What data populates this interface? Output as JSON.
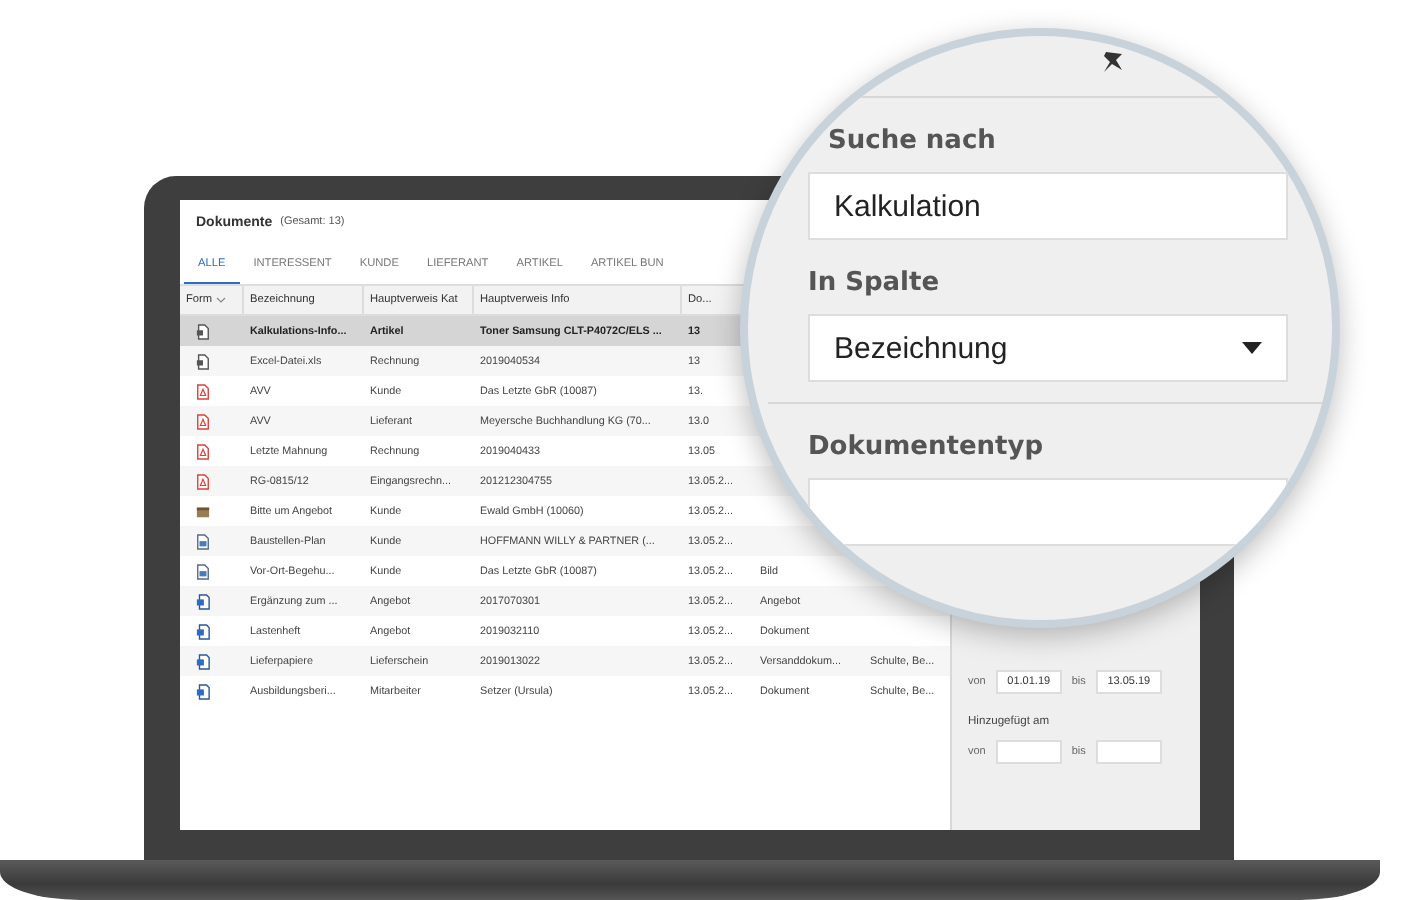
{
  "screen": {
    "title": "Dokumente",
    "count": "(Gesamt: 13)",
    "tabs": [
      {
        "label": "ALLE",
        "selected": true
      },
      {
        "label": "INTERESSENT",
        "selected": false
      },
      {
        "label": "KUNDE",
        "selected": false
      },
      {
        "label": "LIEFERANT",
        "selected": false
      },
      {
        "label": "ARTIKEL",
        "selected": false
      },
      {
        "label": "ARTIKEL BUN",
        "selected": false
      }
    ],
    "table": {
      "form_column": "Form",
      "columns": [
        "Bezeichnung",
        "Hauptverweis Kat",
        "Hauptverweis Info",
        "Do..."
      ],
      "rows": [
        {
          "kind": "file",
          "selected": true,
          "cells": [
            "Kalkulations-Info...",
            "Artikel",
            "Toner Samsung CLT-P4072C/ELS ...",
            "13"
          ]
        },
        {
          "kind": "file",
          "selected": false,
          "cells": [
            "Excel-Datei.xls",
            "Rechnung",
            "2019040534",
            "13"
          ]
        },
        {
          "kind": "pdf",
          "selected": false,
          "cells": [
            "AVV",
            "Kunde",
            "Das Letzte GbR (10087)",
            "13."
          ]
        },
        {
          "kind": "pdf",
          "selected": false,
          "cells": [
            "AVV",
            "Lieferant",
            "Meyersche Buchhandlung KG (70...",
            "13.0"
          ]
        },
        {
          "kind": "pdf",
          "selected": false,
          "cells": [
            "Letzte Mahnung",
            "Rechnung",
            "2019040433",
            "13.05"
          ]
        },
        {
          "kind": "pdf",
          "selected": false,
          "cells": [
            "RG-0815/12",
            "Eingangsrechn...",
            "201212304755",
            "13.05.2..."
          ]
        },
        {
          "kind": "box",
          "selected": false,
          "cells": [
            "Bitte um Angebot",
            "Kunde",
            "Ewald GmbH (10060)",
            "13.05.2..."
          ]
        },
        {
          "kind": "image",
          "selected": false,
          "cells": [
            "Baustellen-Plan",
            "Kunde",
            "HOFFMANN WILLY & PARTNER (...",
            "13.05.2..."
          ]
        },
        {
          "kind": "image",
          "selected": false,
          "cells": [
            "Vor-Ort-Begehu...",
            "Kunde",
            "Das Letzte GbR (10087)",
            "13.05.2...",
            "Bild"
          ]
        },
        {
          "kind": "word",
          "selected": false,
          "cells": [
            "Ergänzung zum ...",
            "Angebot",
            "2017070301",
            "13.05.2...",
            "Angebot"
          ]
        },
        {
          "kind": "word",
          "selected": false,
          "cells": [
            "Lastenheft",
            "Angebot",
            "2019032110",
            "13.05.2...",
            "Dokument"
          ]
        },
        {
          "kind": "word",
          "selected": false,
          "cells": [
            "Lieferpapiere",
            "Lieferschein",
            "2019013022",
            "13.05.2...",
            "Versanddokum...",
            "Schulte, Be..."
          ]
        },
        {
          "kind": "word",
          "selected": false,
          "cells": [
            "Ausbildungsberi...",
            "Mitarbeiter",
            "Setzer (Ursula)",
            "13.05.2...",
            "Dokument",
            "Schulte, Be..."
          ]
        }
      ]
    },
    "filter_panel": {
      "date_range": {
        "from_label": "von",
        "from": "01.01.19",
        "to_label": "bis",
        "to": "13.05.19"
      },
      "added": {
        "label": "Hinzugefügt am",
        "from_label": "von",
        "to_label": "bis"
      }
    }
  },
  "magnifier": {
    "search_label": "Suche nach",
    "search_value": "Kalkulation",
    "column_label": "In Spalte",
    "column_value": "Bezeichnung",
    "doctype_label": "Dokumententyp"
  }
}
